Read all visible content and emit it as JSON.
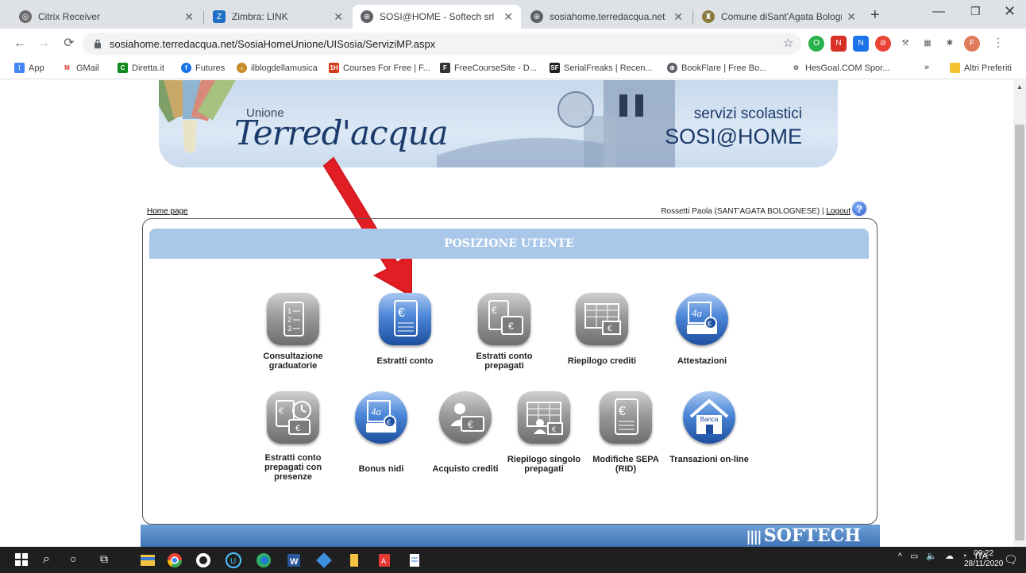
{
  "tabs": [
    {
      "title": "Citrix Receiver",
      "icon": "citrix-icon",
      "color": "#6b6b6b"
    },
    {
      "title": "Zimbra: LINK",
      "icon": "zimbra-icon",
      "color": "#1f6fc5"
    },
    {
      "title": "SOSI@HOME - Softech srl",
      "icon": "globe-icon",
      "color": "#5f6368",
      "active": true
    },
    {
      "title": "sosiahome.terredacqua.net",
      "icon": "globe-icon",
      "color": "#5f6368"
    },
    {
      "title": "Comune diSant'Agata Bologne",
      "icon": "crest-icon",
      "color": "#8a7a3c"
    }
  ],
  "url": "sosiahome.terredacqua.net/SosiaHomeUnione/UISosia/ServiziMP.aspx",
  "bookmarks": [
    "App",
    "GMail",
    "Diretta.it",
    "Futures",
    "ilblogdellamusica",
    "Courses For Free | F...",
    "FreeCourseSite - D...",
    "SerialFreaks | Recen...",
    "BookFlare | Free Bo...",
    "HesGoal.COM Spor..."
  ],
  "bookmarks_more": "»",
  "bookmarks_other": "Altri Preferiti",
  "banner": {
    "union": "Unione",
    "logo": "Terred'acqua",
    "subtitle": "servizi scolastici",
    "name": "SOSI@HOME"
  },
  "breadcrumb": {
    "home": "Home page",
    "user": "Rossetti Paola (SANT'AGATA BOLOGNESE) | ",
    "logout": "Logout"
  },
  "panel_title": "POSIZIONE UTENTE",
  "tiles_row1": [
    {
      "label": "Consultazione graduatorie",
      "icon": "ranking-list-icon",
      "style": "gray"
    },
    {
      "label": "Estratti conto",
      "icon": "euro-document-icon",
      "style": "blue"
    },
    {
      "label": "Estratti conto prepagati",
      "icon": "euro-documents-icon",
      "style": "gray"
    },
    {
      "label": "Riepilogo crediti",
      "icon": "credit-table-icon",
      "style": "gray"
    },
    {
      "label": "Attestazioni",
      "icon": "certificate-printer-icon",
      "style": "blue"
    }
  ],
  "tiles_row2": [
    {
      "label": "Estratti conto prepagati con presenze",
      "icon": "clock-documents-icon",
      "style": "gray"
    },
    {
      "label": "Bonus nidi",
      "icon": "bonus-printer-icon",
      "style": "blue"
    },
    {
      "label": "Acquisto crediti",
      "icon": "buy-credit-icon",
      "style": "gray"
    },
    {
      "label": "Riepilogo singolo prepagati",
      "icon": "user-table-icon",
      "style": "gray"
    },
    {
      "label": "Modifiche SEPA (RID)",
      "icon": "euro-doc-gray-icon",
      "style": "gray"
    },
    {
      "label": "Transazioni on-line",
      "icon": "bank-house-icon",
      "style": "blue"
    }
  ],
  "bank_label": "Banca",
  "footer_brand": "SOFTECH",
  "taskbar": {
    "lang": "ITA",
    "time": "09:22",
    "date": "28/11/2020"
  }
}
